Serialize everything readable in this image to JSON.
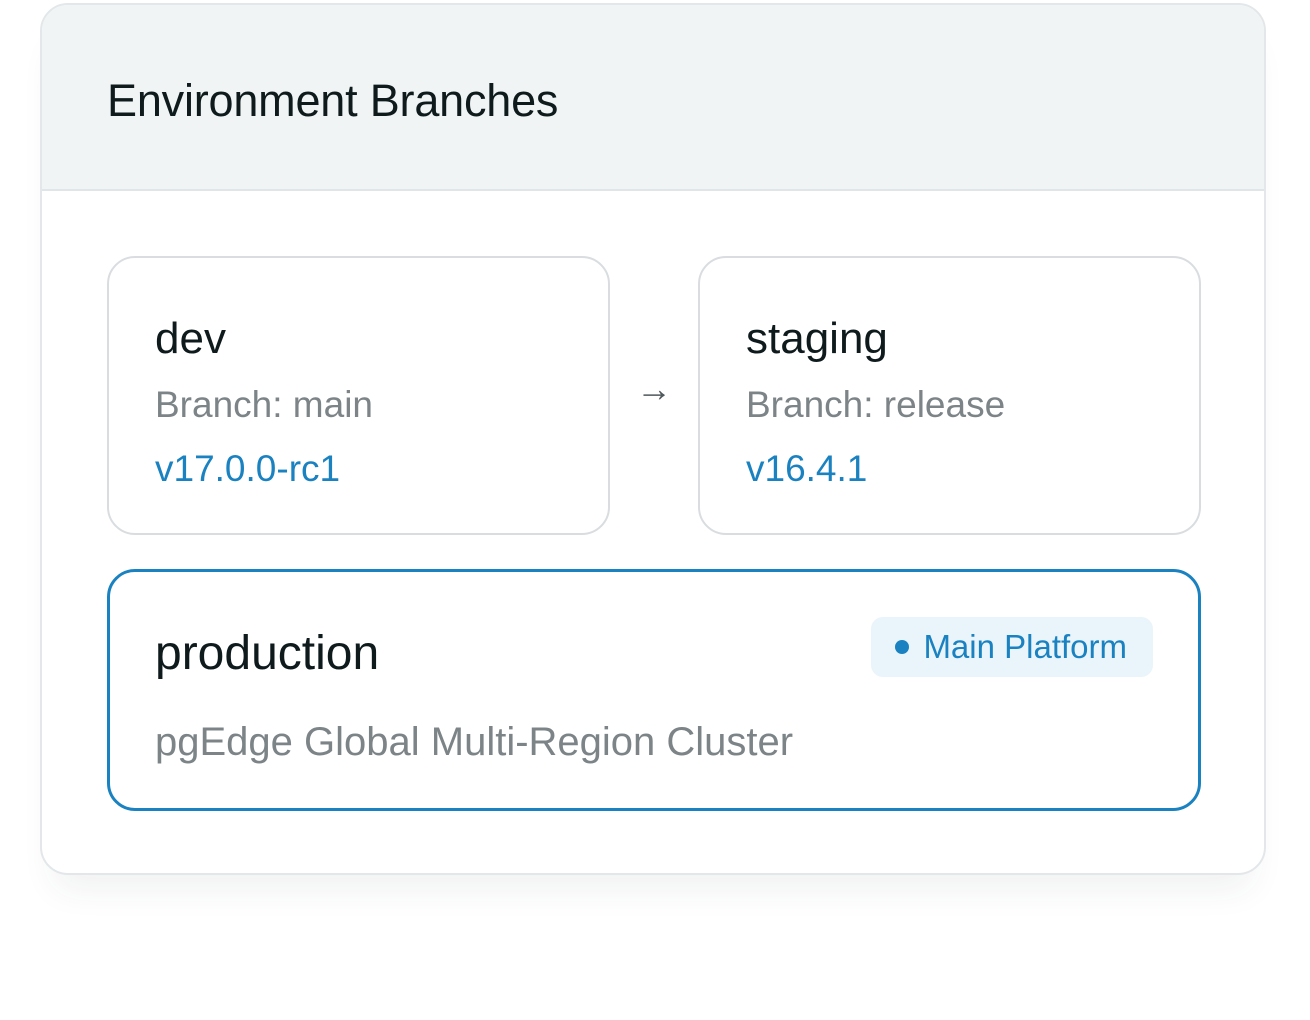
{
  "panel": {
    "title": "Environment Branches"
  },
  "environments": {
    "dev": {
      "name": "dev",
      "branch": "Branch: main",
      "version": "v17.0.0-rc1"
    },
    "staging": {
      "name": "staging",
      "branch": "Branch: release",
      "version": "v16.4.1"
    },
    "production": {
      "name": "production",
      "description": "pgEdge Global Multi-Region Cluster",
      "badge": "Main Platform"
    }
  },
  "flow": {
    "arrow": "→"
  },
  "colors": {
    "accent": "#1a82c0",
    "badge_bg": "#e9f4fb",
    "header_bg": "#f0f4f5",
    "muted_text": "#7c8487"
  }
}
